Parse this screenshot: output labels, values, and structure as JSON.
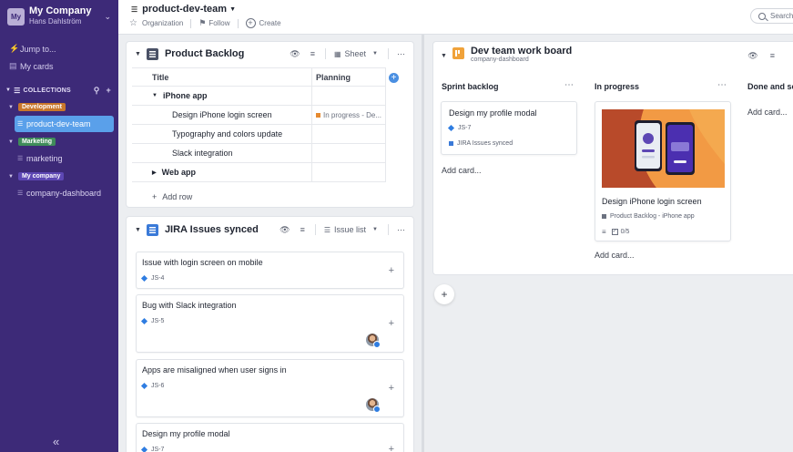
{
  "workspace": {
    "initials": "My",
    "name": "My Company",
    "user": "Hans Dahlström"
  },
  "sidebar": {
    "links": [
      {
        "icon": "jump-icon",
        "label": "Jump to..."
      },
      {
        "icon": "cards-icon",
        "label": "My cards"
      }
    ],
    "collections_label": "COLLECTIONS",
    "groups": [
      {
        "label": "Development",
        "color": "#c9772b",
        "items": [
          "product-dev-team"
        ]
      },
      {
        "label": "Marketing",
        "color": "#3f8c5a",
        "items": [
          "marketing"
        ]
      },
      {
        "label": "My company",
        "color": "#5d47b4",
        "items": [
          "company-dashboard"
        ]
      }
    ],
    "active_item": "product-dev-team",
    "collapse_glyph": "«"
  },
  "header": {
    "title": "product-dev-team",
    "organization": "Organization",
    "follow": "Follow",
    "create": "Create",
    "search_placeholder": "Search"
  },
  "backlog": {
    "title": "Product Backlog",
    "view": "Sheet",
    "columns": [
      "Title",
      "Planning"
    ],
    "rows": [
      {
        "title": "iPhone app",
        "group": true,
        "expanded": true,
        "planning": ""
      },
      {
        "title": "Design iPhone login screen",
        "group": false,
        "planning": "In progress - De..."
      },
      {
        "title": "Typography and colors update",
        "group": false,
        "planning": ""
      },
      {
        "title": "Slack integration",
        "group": false,
        "planning": ""
      },
      {
        "title": "Web app",
        "group": true,
        "expanded": false,
        "planning": ""
      }
    ],
    "add_row": "Add row"
  },
  "jira": {
    "title": "JIRA Issues synced",
    "view": "Issue list",
    "issues": [
      {
        "title": "Issue with login screen on mobile",
        "key": "JS-4",
        "avatar": false
      },
      {
        "title": "Bug with Slack integration",
        "key": "JS-5",
        "avatar": true
      },
      {
        "title": "Apps are misaligned when user signs in",
        "key": "JS-6",
        "avatar": true
      },
      {
        "title": "Design my profile modal",
        "key": "JS-7",
        "avatar": false
      }
    ]
  },
  "board": {
    "title": "Dev team work board",
    "subtitle": "company-dashboard",
    "columns": [
      {
        "title": "Sprint backlog",
        "add_card": "Add card..."
      },
      {
        "title": "In progress",
        "add_card": "Add card..."
      },
      {
        "title": "Done and se",
        "add_card": "Add card..."
      }
    ],
    "sprint_card": {
      "title": "Design my profile modal",
      "key": "JS-7",
      "source": "JIRA Issues synced"
    },
    "progress_card": {
      "title": "Design iPhone login screen",
      "source": "Product Backlog - iPhone app",
      "checklist": "0/5"
    }
  },
  "colors": {
    "sidebar": "#3d2a78",
    "accent": "#5aa0ea",
    "jira": "#2f7de1",
    "board_icon": "#f0a23a"
  }
}
